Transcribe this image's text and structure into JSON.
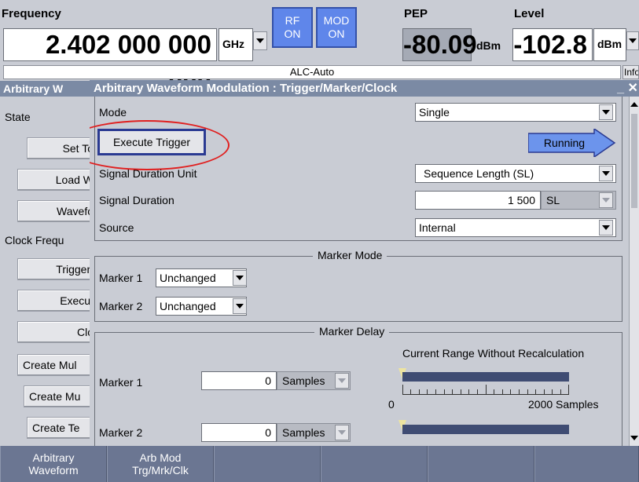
{
  "header": {
    "frequency_label": "Frequency",
    "frequency_value": "2.402 000 000 000",
    "frequency_unit": "GHz",
    "rf_toggle": "RF\nON",
    "mod_toggle": "MOD\nON",
    "pep_label": "PEP",
    "pep_value": "-80.09",
    "pep_unit": "dBm",
    "level_label": "Level",
    "level_value": "-102.8",
    "level_unit": "dBm",
    "alc_status": "ALC-Auto",
    "info_tab": "Info"
  },
  "background_dialog": {
    "title": "Arbitrary W",
    "state_label": "State",
    "buttons": [
      "Set To",
      "Load W",
      "Wavefo"
    ],
    "clock_freq_label": "Clock Frequ",
    "buttons2": [
      "Trigger/",
      "Execut",
      "Clo"
    ],
    "buttons3": [
      "Create Mul",
      "Create Mu",
      "Create Te"
    ]
  },
  "dialog": {
    "title": "Arbitrary Waveform Modulation : Trigger/Marker/Clock",
    "close_icon": "close-icon",
    "mode_label": "Mode",
    "mode_value": "Single",
    "execute_trigger_label": "Execute Trigger",
    "running_label": "Running",
    "signal_duration_unit_label": "Signal Duration Unit",
    "signal_duration_unit_value": "Sequence Length (SL)",
    "signal_duration_label": "Signal Duration",
    "signal_duration_value": "1 500",
    "signal_duration_unit_short": "SL",
    "source_label": "Source",
    "source_value": "Internal",
    "marker_mode": {
      "title": "Marker Mode",
      "marker1_label": "Marker 1",
      "marker1_value": "Unchanged",
      "marker2_label": "Marker 2",
      "marker2_value": "Unchanged"
    },
    "marker_delay": {
      "title": "Marker Delay",
      "range_caption": "Current Range Without Recalculation",
      "marker1_label": "Marker 1",
      "marker1_value": "0",
      "marker1_unit": "Samples",
      "range_min": "0",
      "range_max": "2000 Samples",
      "marker2_label": "Marker 2",
      "marker2_value": "0",
      "marker2_unit": "Samples"
    }
  },
  "softkeys": [
    "Arbitrary\nWaveform",
    "Arb Mod\nTrg/Mrk/Clk",
    "",
    "",
    "",
    ""
  ],
  "colors": {
    "toggle_blue": "#5f86ea",
    "title_bar": "#7b8aa4",
    "highlight_red": "#e02020",
    "running_blue": "#6c94ec"
  }
}
